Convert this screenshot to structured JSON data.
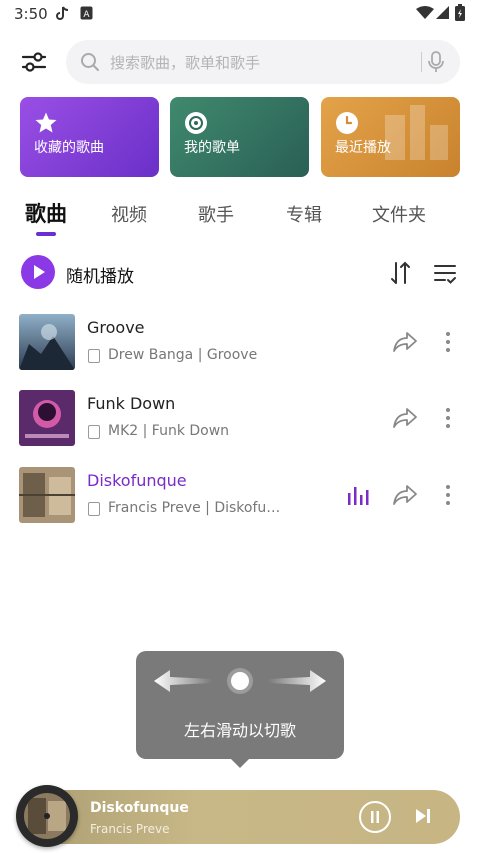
{
  "status": {
    "time": "3:50"
  },
  "search": {
    "placeholder": "搜索歌曲，歌单和歌手"
  },
  "cards": [
    {
      "label": "收藏的歌曲"
    },
    {
      "label": "我的歌单"
    },
    {
      "label": "最近播放"
    }
  ],
  "tabs": [
    {
      "label": "歌曲",
      "active": true
    },
    {
      "label": "视频"
    },
    {
      "label": "歌手"
    },
    {
      "label": "专辑"
    },
    {
      "label": "文件夹"
    }
  ],
  "shuffle": {
    "label": "随机播放"
  },
  "songs": [
    {
      "title": "Groove",
      "subtitle": "Drew Banga | Groove"
    },
    {
      "title": "Funk Down",
      "subtitle": "MK2 | Funk Down"
    },
    {
      "title": "Diskofunque",
      "subtitle": "Francis Preve | Diskofunque",
      "playing": true
    }
  ],
  "tooltip": {
    "text": "左右滑动以切歌"
  },
  "player": {
    "title": "Diskofunque",
    "artist": "Francis Preve"
  },
  "colors": {
    "accent": "#7a2bc8",
    "tab_indicator": "#6a2fd3"
  }
}
